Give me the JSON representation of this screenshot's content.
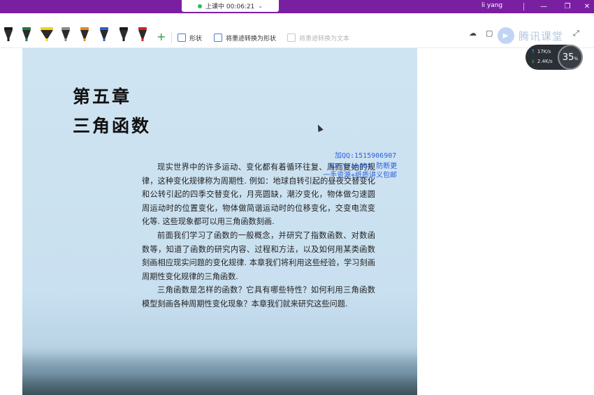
{
  "titlebar": {
    "live_status": "上课中 00:06:21",
    "username": "li yang",
    "minimize": "—",
    "restore": "❐",
    "close": "✕"
  },
  "toolbar": {
    "pens": [
      {
        "color": "#1a1a1a"
      },
      {
        "color": "#1f7a3a"
      },
      {
        "color": "#f2d500"
      },
      {
        "color": "#8a8a8a"
      },
      {
        "color": "#e88a14"
      },
      {
        "color": "#2b5fc9"
      },
      {
        "color": "#1a1a1a"
      },
      {
        "color": "#d42020"
      }
    ],
    "add": "+",
    "shape_label": "形状",
    "convert_shape_label": "将墨迹转换为形状",
    "convert_text_label": "将墨迹转换为文本"
  },
  "logo": {
    "text": "腾讯课堂"
  },
  "network": {
    "up": "17K/s",
    "down": "2.4K/s",
    "percent": "35",
    "percent_unit": "%"
  },
  "page": {
    "chapter_no": "第五章",
    "chapter_title": "三角函数",
    "paragraphs": [
      "现实世界中的许多运动、变化都有着循环往复、周而复始的规律，这种变化规律称为周期性. 例如：地球自转引起的昼夜交替变化和公转引起的四季交替变化，月亮圆缺，潮汐变化，物体做匀速圆周运动时的位置变化，物体做简谐运动时的位移变化，交变电流变化等. 这些现象都可以用三角函数刻画.",
      "前面我们学习了函数的一般概念，并研究了指数函数、对数函数等，知道了函数的研究内容、过程和方法，以及如何用某类函数刻画相应现实问题的变化规律. 本章我们将利用这些经验，学习刻画周期性变化规律的三角函数.",
      "三角函数是怎样的函数？它具有哪些特性？如何利用三角函数模型刻画各种周期性变化现象？本章我们就来研究这些问题."
    ]
  },
  "watermark": {
    "line1": "加QQ:1515906907",
    "line2": "WX:YFan885 防断更",
    "line3": "一手资源+纸质讲义包邮"
  }
}
